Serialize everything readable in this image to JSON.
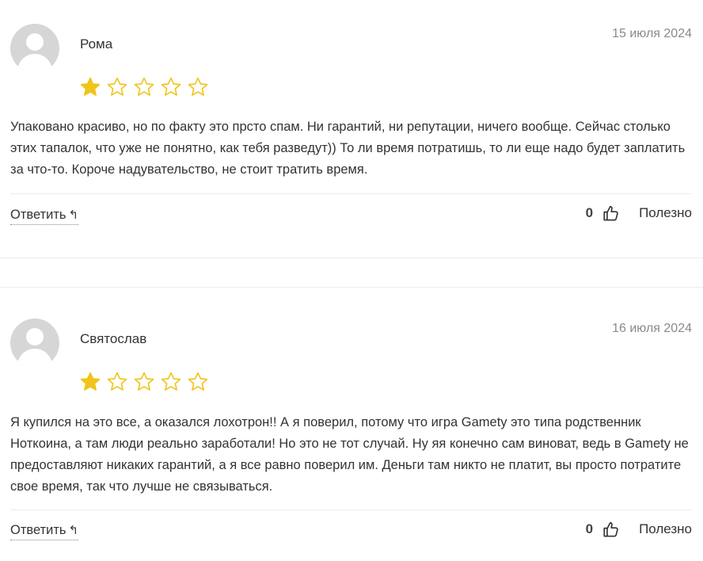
{
  "colors": {
    "star_filled": "#f0c419",
    "star_outline": "#f0c419",
    "avatar_bg": "#d6d6d6",
    "divider": "#ececec"
  },
  "reviews": [
    {
      "author": "Рома",
      "date": "15 июля 2024",
      "rating": 1,
      "max_rating": 5,
      "text": "Упаковано красиво, но по факту это прсто спам. Ни гарантий, ни репутации, ничего вообще. Сейчас столько этих тапалок, что уже не понятно, как тебя разведут)) То ли время потратишь, то ли еще надо будет заплатить за что-то. Короче надувательство, не стоит тратить время.",
      "reply_label": "Ответить",
      "reply_icon": "↰",
      "helpful_count": "0",
      "helpful_label": "Полезно"
    },
    {
      "author": "Святослав",
      "date": "16 июля 2024",
      "rating": 1,
      "max_rating": 5,
      "text": "Я купился на это все, а оказался лохотрон!! А я поверил, потому что игра Gamety это типа родственник Ноткоина, а там люди реально заработали! Но это не тот случай. Ну яя конечно сам виноват, ведь в Gamety не предоставляют никаких гарантий, а я все равно поверил им. Деньги там никто не платит, вы просто потратите свое время, так что лучше не связываться.",
      "reply_label": "Ответить",
      "reply_icon": "↰",
      "helpful_count": "0",
      "helpful_label": "Полезно"
    }
  ]
}
